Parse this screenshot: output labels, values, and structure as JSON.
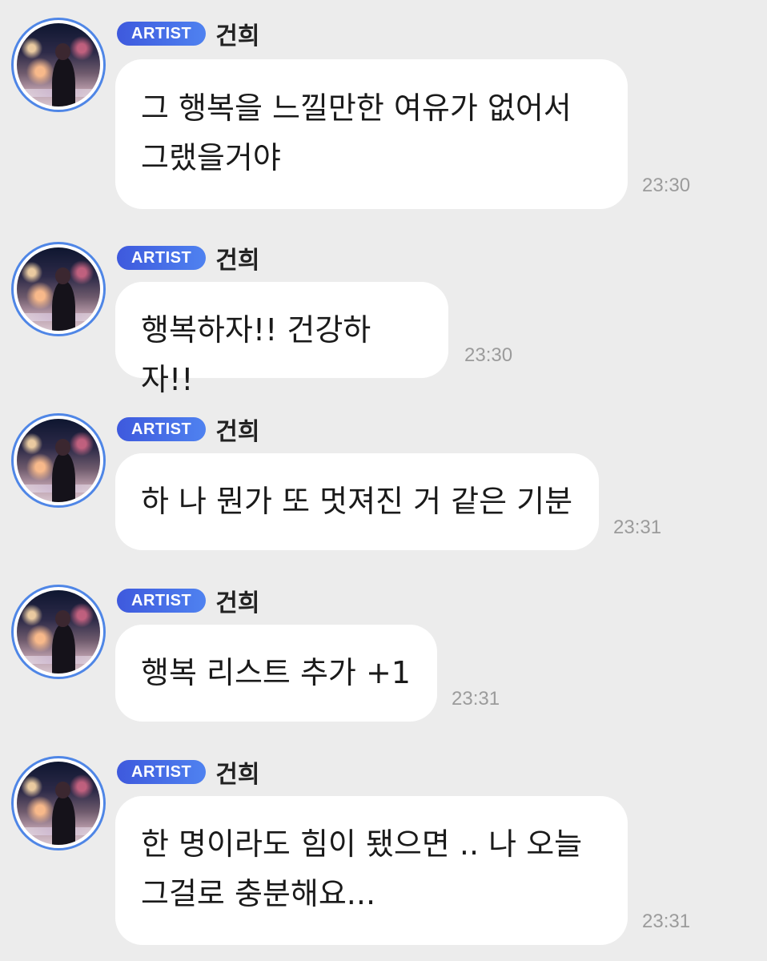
{
  "messages": [
    {
      "badge": "ARTIST",
      "sender": "건희",
      "text": "그 행복을 느낄만한 여유가 없어서\n그랬을거야",
      "time": "23:30"
    },
    {
      "badge": "ARTIST",
      "sender": "건희",
      "text": "행복하자!! 건강하자!!",
      "time": "23:30"
    },
    {
      "badge": "ARTIST",
      "sender": "건희",
      "text": "하 나 뭔가 또 멋져진 거 같은 기분",
      "time": "23:31"
    },
    {
      "badge": "ARTIST",
      "sender": "건희",
      "text": "행복 리스트 추가 +1",
      "time": "23:31"
    },
    {
      "badge": "ARTIST",
      "sender": "건희",
      "text": "한 명이라도 힘이 됐으면 .. 나 오늘\n그걸로 충분해요...",
      "time": "23:31"
    }
  ],
  "colors": {
    "background": "#ececec",
    "badge": "#4566e4",
    "avatar_ring": "#4f86e6",
    "time": "#9b9b9b"
  },
  "icons": {
    "avatar": "profile-photo"
  }
}
